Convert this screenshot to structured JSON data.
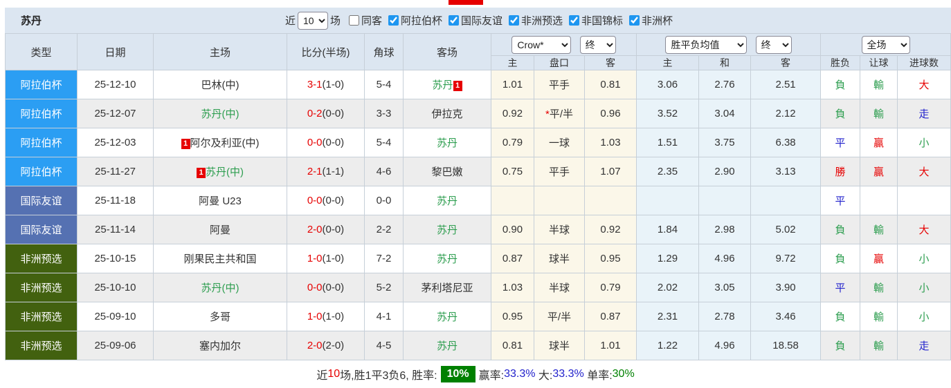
{
  "header": {
    "team_title": "苏丹"
  },
  "filter_bar": {
    "recent_label": "近",
    "recent_value": "10",
    "matches_label": "场",
    "same_venue": {
      "label": "同客",
      "checked": false
    },
    "competitions": [
      {
        "label": "阿拉伯杯",
        "checked": true
      },
      {
        "label": "国际友谊",
        "checked": true
      },
      {
        "label": "非洲预选",
        "checked": true
      },
      {
        "label": "非国锦标",
        "checked": true
      },
      {
        "label": "非洲杯",
        "checked": true
      }
    ]
  },
  "table": {
    "columns": [
      "类型",
      "日期",
      "主场",
      "比分(半场)",
      "角球",
      "客场"
    ],
    "selects": {
      "company": "Crow*",
      "company_time": "终",
      "mean": "胜平负均值",
      "mean_time": "终",
      "scope": "全场"
    },
    "sub_columns": [
      "主",
      "盘口",
      "客",
      "主",
      "和",
      "客",
      "胜负",
      "让球",
      "进球数"
    ],
    "badge_label": "1",
    "rows": [
      {
        "type": "阿拉伯杯",
        "type_key": "arab",
        "date": "25-12-10",
        "home": {
          "name": "巴林(中)",
          "green": false,
          "badge": null
        },
        "score_full": "3-1",
        "score_half": "(1-0)",
        "corner": "5-4",
        "away": {
          "name": "苏丹",
          "green": true,
          "badge": "after"
        },
        "odds": [
          "1.01",
          "平手",
          "0.81"
        ],
        "odds_star": false,
        "mean": [
          "3.06",
          "2.76",
          "2.51"
        ],
        "result": [
          {
            "t": "負",
            "c": "green"
          },
          {
            "t": "輸",
            "c": "green"
          },
          {
            "t": "大",
            "c": "red"
          }
        ]
      },
      {
        "type": "阿拉伯杯",
        "type_key": "arab",
        "date": "25-12-07",
        "home": {
          "name": "苏丹(中)",
          "green": true,
          "badge": null
        },
        "score_full": "0-2",
        "score_half": "(0-0)",
        "corner": "3-3",
        "away": {
          "name": "伊拉克",
          "green": false,
          "badge": null
        },
        "odds": [
          "0.92",
          "平/半",
          "0.96"
        ],
        "odds_star": true,
        "mean": [
          "3.52",
          "3.04",
          "2.12"
        ],
        "result": [
          {
            "t": "負",
            "c": "green"
          },
          {
            "t": "輸",
            "c": "green"
          },
          {
            "t": "走",
            "c": "blue"
          }
        ]
      },
      {
        "type": "阿拉伯杯",
        "type_key": "arab",
        "date": "25-12-03",
        "home": {
          "name": "阿尔及利亚(中)",
          "green": false,
          "badge": "before"
        },
        "score_full": "0-0",
        "score_half": "(0-0)",
        "corner": "5-4",
        "away": {
          "name": "苏丹",
          "green": true,
          "badge": null
        },
        "odds": [
          "0.79",
          "一球",
          "1.03"
        ],
        "odds_star": false,
        "mean": [
          "1.51",
          "3.75",
          "6.38"
        ],
        "result": [
          {
            "t": "平",
            "c": "blue"
          },
          {
            "t": "贏",
            "c": "red"
          },
          {
            "t": "小",
            "c": "green"
          }
        ]
      },
      {
        "type": "阿拉伯杯",
        "type_key": "arab",
        "date": "25-11-27",
        "home": {
          "name": "苏丹(中)",
          "green": true,
          "badge": "before"
        },
        "score_full": "2-1",
        "score_half": "(1-1)",
        "corner": "4-6",
        "away": {
          "name": "黎巴嫩",
          "green": false,
          "badge": null
        },
        "odds": [
          "0.75",
          "平手",
          "1.07"
        ],
        "odds_star": false,
        "mean": [
          "2.35",
          "2.90",
          "3.13"
        ],
        "result": [
          {
            "t": "勝",
            "c": "red"
          },
          {
            "t": "贏",
            "c": "red"
          },
          {
            "t": "大",
            "c": "red"
          }
        ]
      },
      {
        "type": "国际友谊",
        "type_key": "friendly",
        "date": "25-11-18",
        "home": {
          "name": "阿曼 U23",
          "green": false,
          "badge": null
        },
        "score_full": "0-0",
        "score_half": "(0-0)",
        "corner": "0-0",
        "away": {
          "name": "苏丹",
          "green": true,
          "badge": null
        },
        "odds": [
          "",
          "",
          ""
        ],
        "odds_star": false,
        "mean": [
          "",
          "",
          ""
        ],
        "result": [
          {
            "t": "平",
            "c": "blue"
          },
          null,
          null
        ]
      },
      {
        "type": "国际友谊",
        "type_key": "friendly",
        "date": "25-11-14",
        "home": {
          "name": "阿曼",
          "green": false,
          "badge": null
        },
        "score_full": "2-0",
        "score_half": "(0-0)",
        "corner": "2-2",
        "away": {
          "name": "苏丹",
          "green": true,
          "badge": null
        },
        "odds": [
          "0.90",
          "半球",
          "0.92"
        ],
        "odds_star": false,
        "mean": [
          "1.84",
          "2.98",
          "5.02"
        ],
        "result": [
          {
            "t": "負",
            "c": "green"
          },
          {
            "t": "輸",
            "c": "green"
          },
          {
            "t": "大",
            "c": "red"
          }
        ]
      },
      {
        "type": "非洲预选",
        "type_key": "africanq",
        "date": "25-10-15",
        "home": {
          "name": "刚果民主共和国",
          "green": false,
          "badge": null
        },
        "score_full": "1-0",
        "score_half": "(1-0)",
        "corner": "7-2",
        "away": {
          "name": "苏丹",
          "green": true,
          "badge": null
        },
        "odds": [
          "0.87",
          "球半",
          "0.95"
        ],
        "odds_star": false,
        "mean": [
          "1.29",
          "4.96",
          "9.72"
        ],
        "result": [
          {
            "t": "負",
            "c": "green"
          },
          {
            "t": "贏",
            "c": "red"
          },
          {
            "t": "小",
            "c": "green"
          }
        ]
      },
      {
        "type": "非洲预选",
        "type_key": "africanq",
        "date": "25-10-10",
        "home": {
          "name": "苏丹(中)",
          "green": true,
          "badge": null
        },
        "score_full": "0-0",
        "score_half": "(0-0)",
        "corner": "5-2",
        "away": {
          "name": "茅利塔尼亚",
          "green": false,
          "badge": null
        },
        "odds": [
          "1.03",
          "半球",
          "0.79"
        ],
        "odds_star": false,
        "mean": [
          "2.02",
          "3.05",
          "3.90"
        ],
        "result": [
          {
            "t": "平",
            "c": "blue"
          },
          {
            "t": "輸",
            "c": "green"
          },
          {
            "t": "小",
            "c": "green"
          }
        ]
      },
      {
        "type": "非洲预选",
        "type_key": "africanq",
        "date": "25-09-10",
        "home": {
          "name": "多哥",
          "green": false,
          "badge": null
        },
        "score_full": "1-0",
        "score_half": "(1-0)",
        "corner": "4-1",
        "away": {
          "name": "苏丹",
          "green": true,
          "badge": null
        },
        "odds": [
          "0.95",
          "平/半",
          "0.87"
        ],
        "odds_star": false,
        "mean": [
          "2.31",
          "2.78",
          "3.46"
        ],
        "result": [
          {
            "t": "負",
            "c": "green"
          },
          {
            "t": "輸",
            "c": "green"
          },
          {
            "t": "小",
            "c": "green"
          }
        ]
      },
      {
        "type": "非洲预选",
        "type_key": "africanq",
        "date": "25-09-06",
        "home": {
          "name": "塞内加尔",
          "green": false,
          "badge": null
        },
        "score_full": "2-0",
        "score_half": "(2-0)",
        "corner": "4-5",
        "away": {
          "name": "苏丹",
          "green": true,
          "badge": null
        },
        "odds": [
          "0.81",
          "球半",
          "1.01"
        ],
        "odds_star": false,
        "mean": [
          "1.22",
          "4.96",
          "18.58"
        ],
        "result": [
          {
            "t": "負",
            "c": "green"
          },
          {
            "t": "輸",
            "c": "green"
          },
          {
            "t": "走",
            "c": "blue"
          }
        ]
      }
    ]
  },
  "summary": {
    "segments": [
      {
        "text": "近",
        "color": "#333333"
      },
      {
        "text": "10",
        "color": "#e60000"
      },
      {
        "text": "场,胜1平3负6, 胜率:",
        "color": "#333333"
      },
      {
        "text": "10%",
        "badge": true
      },
      {
        "text": "赢率:",
        "color": "#333333"
      },
      {
        "text": "33.3%",
        "color": "#2222cc"
      },
      {
        "text": " 大:",
        "color": "#333333"
      },
      {
        "text": "33.3%",
        "color": "#2222cc"
      },
      {
        "text": " 单率:",
        "color": "#333333"
      },
      {
        "text": "30%",
        "color": "#008000"
      }
    ]
  },
  "colors": {
    "type_arab": "#2b9ef3",
    "type_friendly": "#5571b2",
    "type_africanq": "#42610f",
    "green_text": "#2e9e50",
    "red_text": "#e60000",
    "blue_text": "#2222cc",
    "badge_red": "#e60000",
    "summary_badge_green": "#008000",
    "header_bg": "#dce6f1",
    "crow_col_bg": "#fbf7e9",
    "mean_col_bg": "#e9f3f9"
  }
}
